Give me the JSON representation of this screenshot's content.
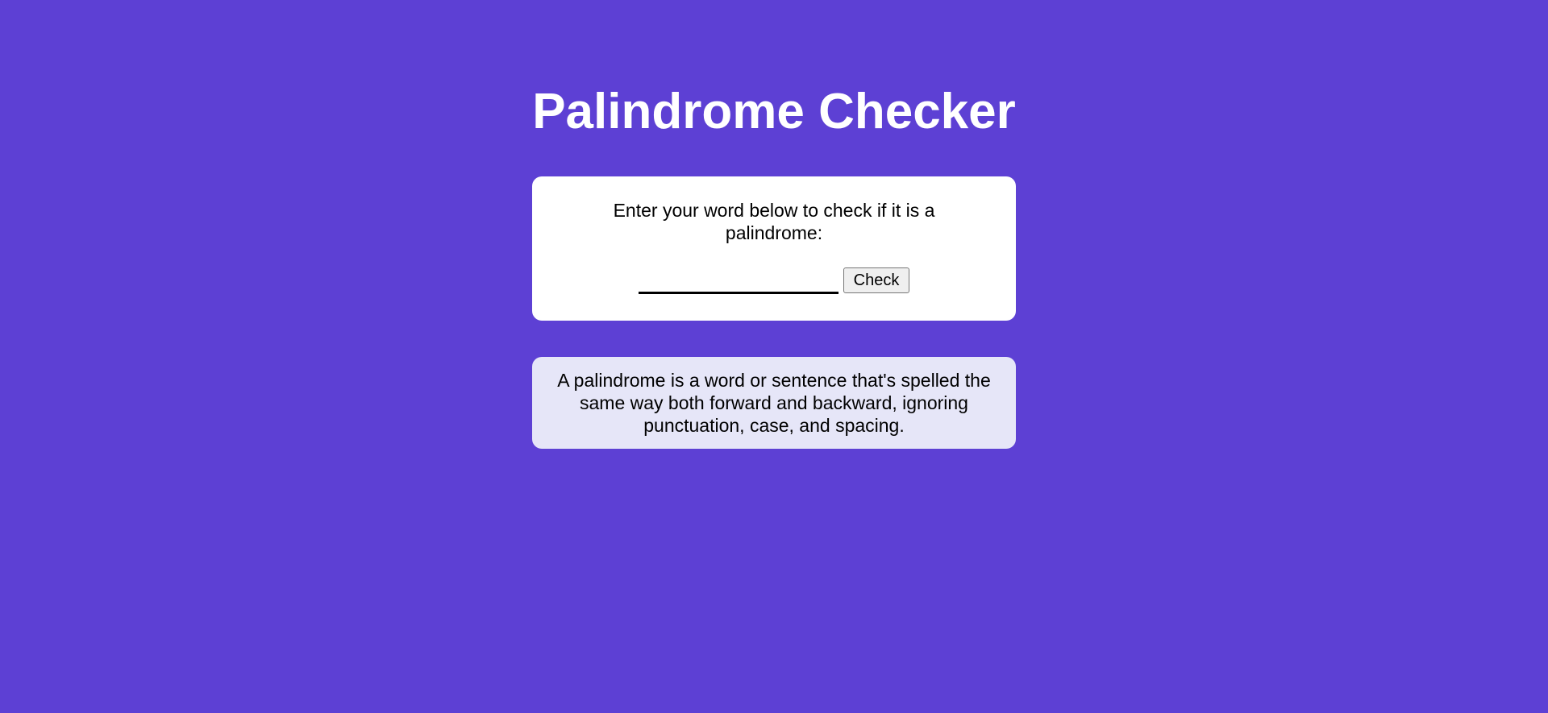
{
  "app": {
    "title": "Palindrome Checker"
  },
  "checker": {
    "prompt": "Enter your word below to check if it is a palindrome:",
    "input_value": "",
    "input_placeholder": "",
    "check_label": "Check"
  },
  "info": {
    "text": "A palindrome is a word or sentence that's spelled the same way both forward and backward, ignoring punctuation, case, and spacing."
  },
  "colors": {
    "background": "#5d40d4",
    "card": "#ffffff",
    "info_card": "#e6e6f8",
    "title_text": "#ffffff"
  }
}
